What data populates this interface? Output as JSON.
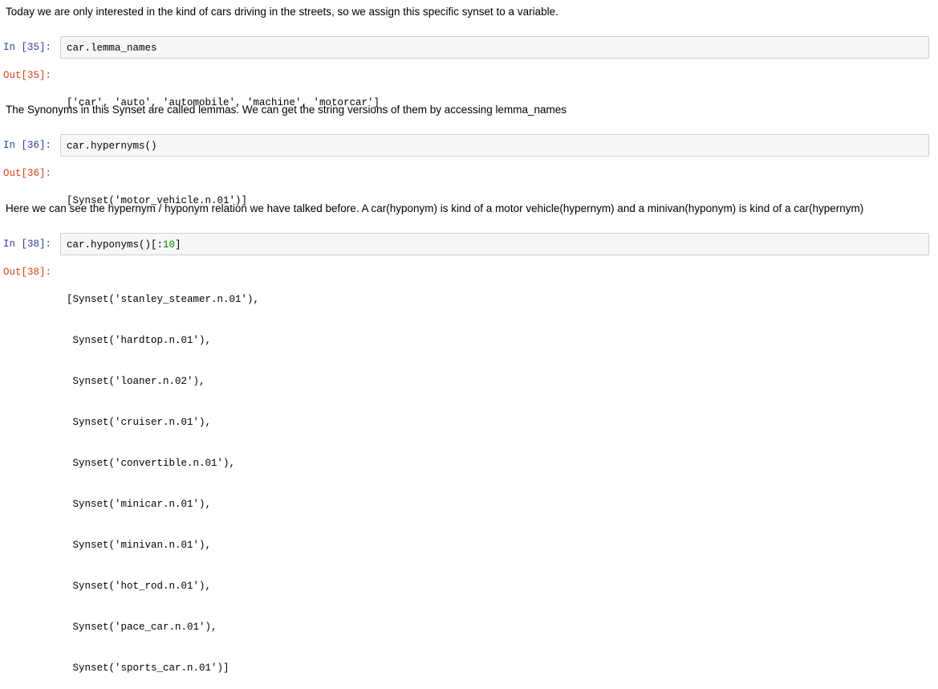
{
  "cells": [
    {
      "markdown": "Today we are only interested in the kind of cars driving in the streets, so we assign this specific synset to a variable."
    },
    {
      "in_prompt": "In [35]:",
      "code": "car.lemma_names",
      "out_prompt": "Out[35]:",
      "output_lines": [
        "['car', 'auto', 'automobile', 'machine', 'motorcar']"
      ]
    },
    {
      "markdown": "The Synonyms in this Synset are called lemmas. We can get the string versions of them by accessing lemma_names"
    },
    {
      "in_prompt": "In [36]:",
      "code": "car.hypernyms()",
      "out_prompt": "Out[36]:",
      "output_lines": [
        "[Synset('motor_vehicle.n.01')]"
      ]
    },
    {
      "markdown": "Here we can see the hypernym / hyponym relation we have talked before. A car(hyponym) is kind of a motor vehicle(hypernym) and a minivan(hyponym) is kind of a car(hypernym)"
    },
    {
      "in_prompt": "In [38]:",
      "code_prefix": "car.hyponyms()[:",
      "code_number": "10",
      "code_suffix": "]",
      "out_prompt": "Out[38]:",
      "output_lines": [
        "[Synset('stanley_steamer.n.01'),",
        " Synset('hardtop.n.01'),",
        " Synset('loaner.n.02'),",
        " Synset('cruiser.n.01'),",
        " Synset('convertible.n.01'),",
        " Synset('minicar.n.01'),",
        " Synset('minivan.n.01'),",
        " Synset('hot_rod.n.01'),",
        " Synset('pace_car.n.01'),",
        " Synset('sports_car.n.01')]"
      ]
    }
  ]
}
